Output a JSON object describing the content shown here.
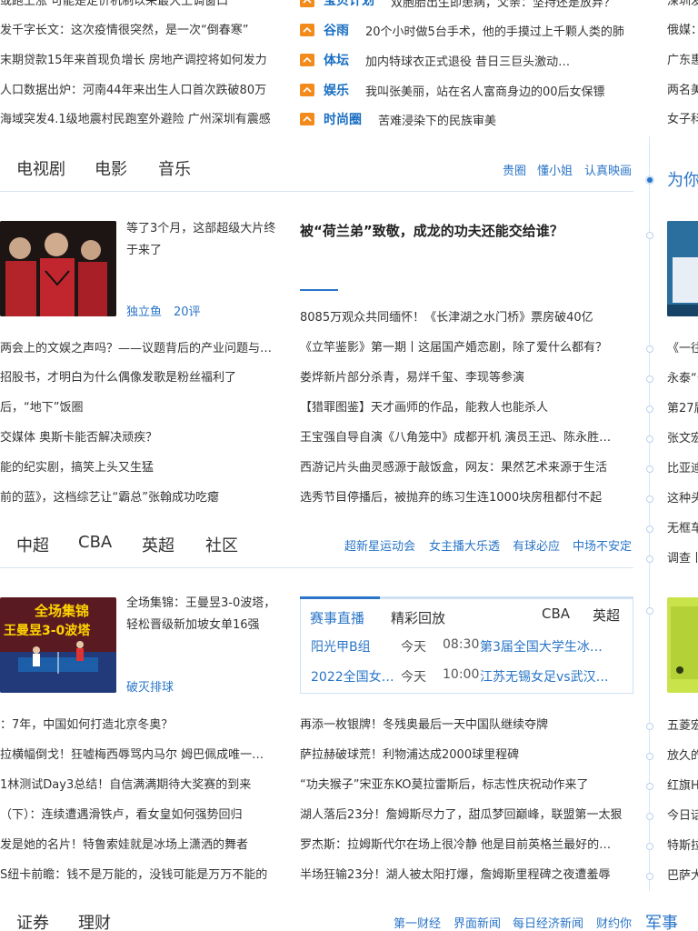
{
  "top_left_news": [
    "或跑上涨 可能是定价机制以来最大上调窗口",
    "发千字长文：这次疫情很突然，是一次“倒春寒”",
    "末期贷款15年来首现负增长 房地产调控将如何发力",
    "人口数据出炉：河南44年来出生人口首次跌破80万",
    "海域突发4.1级地震村民跑室外避险 广州深圳有震感"
  ],
  "top_mid_news": [
    {
      "cat": "宝贝计划",
      "text": "双胞胎出生即患病，父亲：坚持还是放弃？"
    },
    {
      "cat": "谷雨",
      "text": "20个小时做5台手术，他的手摸过上千颗人类的肺"
    },
    {
      "cat": "体坛",
      "text": "加内特球衣正式退役 昔日三巨头激动…"
    },
    {
      "cat": "娱乐",
      "text": "我叫张美丽，站在名人富商身边的00后女保镖"
    },
    {
      "cat": "时尚圈",
      "text": "苦难浸染下的民族审美"
    }
  ],
  "top_right_news": [
    "深圳发布",
    "俄媒：美方",
    "广东惠州",
    "两名美国",
    "女子科三"
  ],
  "ent": {
    "tabs": [
      "电视剧",
      "电影",
      "音乐"
    ],
    "sublinks": [
      "贵圈",
      "懂小姐",
      "认真映画"
    ],
    "feature_text": "等了3个月，这部超级大片终于来了",
    "feature_source": "独立鱼",
    "feature_comments": "20评",
    "headline": "被“荷兰弟”致敬，成龙的功夫还能交给谁？",
    "left_list": [
      "两会上的文娱之声吗？——议题背后的产业问题与…",
      "招股书，才明白为什么偶像发歌是粉丝福利了",
      "后，“地下”饭圈",
      "交媒体 奥斯卡能否解决顽疾？",
      "能的纪实剧，搞笑上头又生猛",
      "前的蓝》，这档综艺让“霸总”张翰成功吃瘪"
    ],
    "mid_list": [
      "8085万观众共同缅怀！《长津湖之水门桥》票房破40亿",
      "《立竿鉴影》第一期丨这届国产婚恋剧，除了爱什么都有？",
      "娄烨新片部分杀青，易烊千玺、李现等参演",
      "【猎罪图鉴】天才画师的作品，能救人也能杀人",
      "王宝强自导自演《八角笼中》成都开机 演员王迅、陈永胜…",
      "西游记片头曲灵感源于敲饭盒，网友：果然艺术来源于生活",
      "选秀节目停播后，被抛弃的练习生连1000块房租都付不起"
    ]
  },
  "sports": {
    "tabs": [
      "中超",
      "CBA",
      "英超",
      "社区"
    ],
    "sublinks": [
      "超新星运动会",
      "女主播大乐透",
      "有球必应",
      "中场不安定"
    ],
    "feature_text": "全场集锦：王曼昱3-0波塔，轻松晋级新加坡女单16强",
    "feature_source": "破灭排球",
    "thumb_caption1": "全场集锦",
    "thumb_caption2": "王曼昱3-0波塔",
    "live_tabs": [
      "赛事直播",
      "精彩回放"
    ],
    "live_right_tabs": [
      "CBA",
      "英超"
    ],
    "live_rows": [
      {
        "team": "阳光甲B组",
        "day": "今天",
        "time": "08:30",
        "event": "第3届全国大学生冰…"
      },
      {
        "team": "2022全国女…",
        "day": "今天",
        "time": "10:00",
        "event": "江苏无锡女足vs武汉…"
      }
    ],
    "left_list": [
      "：7年，中国如何打造北京冬奥？",
      "拉横幅倒戈！狂嘘梅西辱骂内马尔 姆巴佩成唯一…",
      "1林测试Day3总结！自信满满期待大奖赛的到来",
      "（下）：连续遭遇滑铁卢，看女皇如何强势回归",
      "发是她的名片！特鲁索娃就是冰场上潇洒的舞者",
      "S纽卡前瞻：钱不是万能的，没钱可能是万万不能的"
    ],
    "mid_list": [
      "再添一枚银牌！冬残奥最后一天中国队继续夺牌",
      "萨拉赫破球荒！利物浦达成2000球里程碑",
      "“功夫猴子”宋亚东KO莫拉雷斯后，标志性庆祝动作来了",
      "湖人落后23分！詹姆斯尽力了，甜瓜梦回巅峰，联盟第一太狠",
      "罗杰斯：拉姆斯代尔在场上很冷静 他是目前英格兰最好的…",
      "半场狂输23分！湖人被太阳打爆，詹姆斯里程碑之夜遭羞辱"
    ]
  },
  "finance": {
    "tabs": [
      "证券",
      "理财"
    ],
    "sublinks": [
      "第一财经",
      "界面新闻",
      "每日经济新闻",
      "财约你"
    ],
    "next_section": "军事"
  },
  "right_column": {
    "title": "为你",
    "items_a": [
      "《一往",
      "永泰“公",
      "第27届",
      "张文宏",
      "比亚迪",
      "这种头",
      "无框车",
      "调查丨"
    ],
    "items_b": [
      "五菱宏",
      "放久的",
      "红旗H",
      "今日话",
      "特斯拉",
      "巴萨大"
    ]
  },
  "colors": {
    "accent": "#2a75c7",
    "tag_orange": "#f28b1c",
    "rule": "#d8e4f2"
  }
}
